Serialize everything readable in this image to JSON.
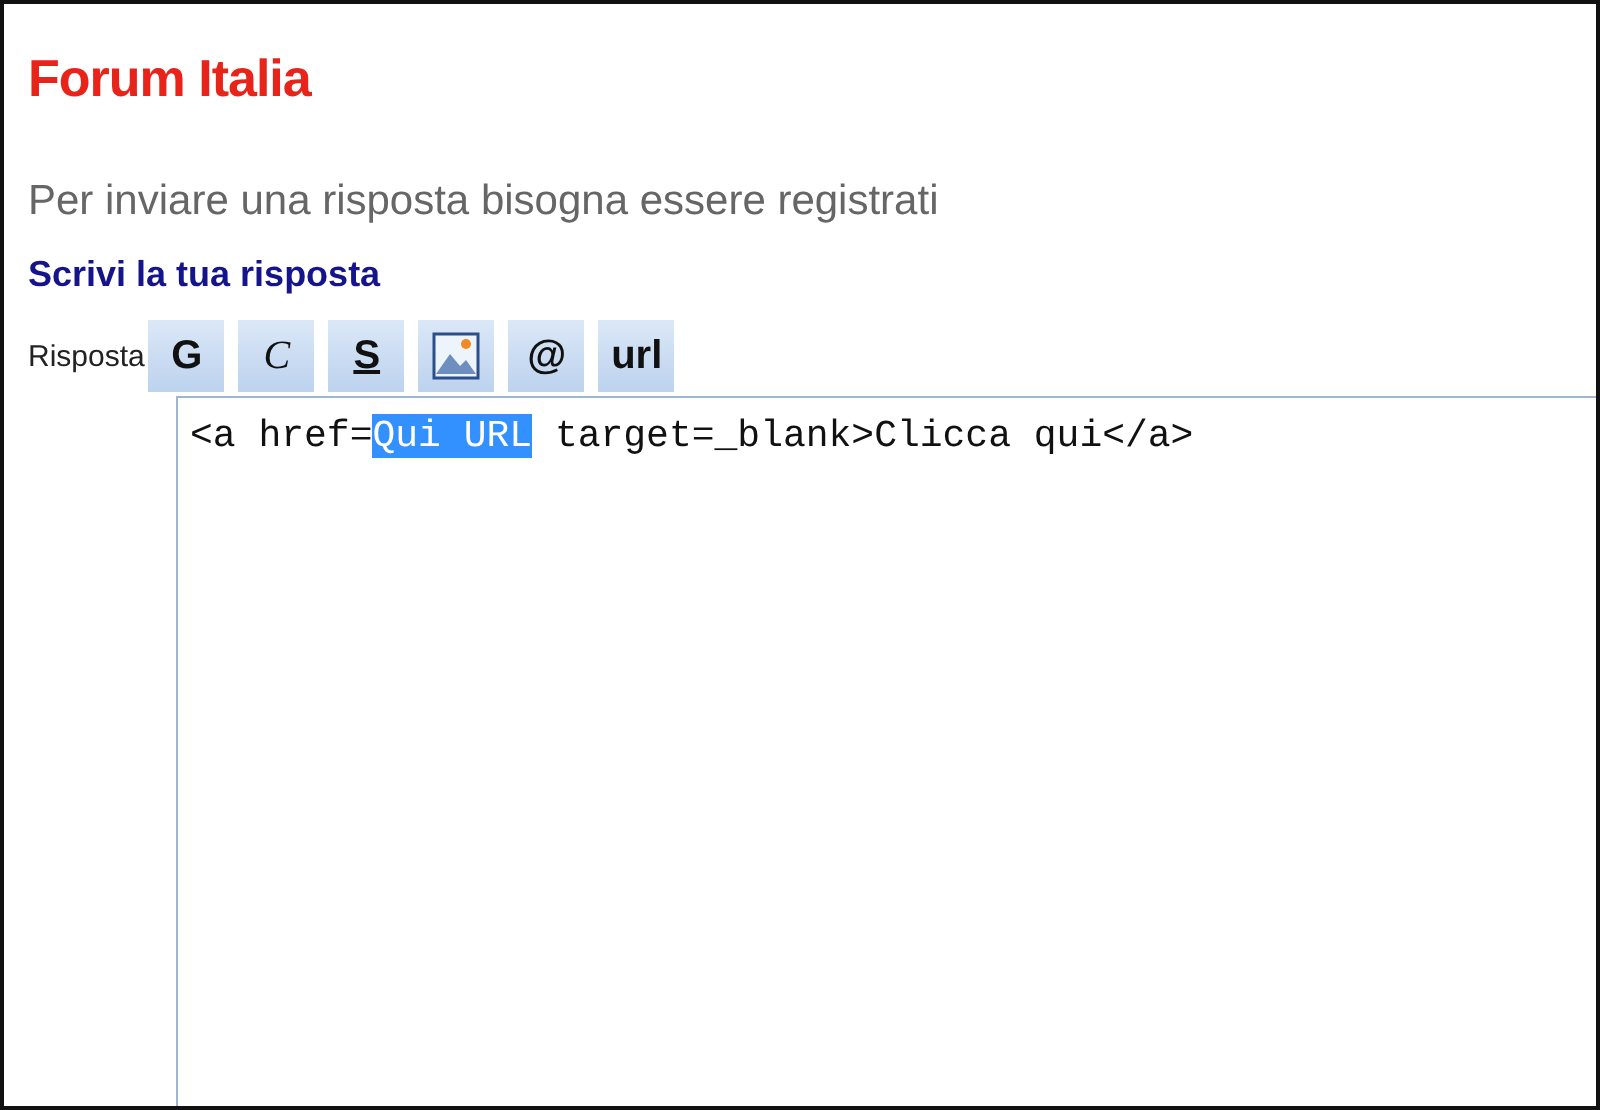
{
  "title": "Forum Italia",
  "notice": "Per inviare una risposta bisogna essere registrati",
  "section_heading": "Scrivi la tua risposta",
  "reply_label": "Risposta",
  "toolbar": [
    {
      "kind": "bold",
      "label": "G"
    },
    {
      "kind": "italic",
      "label": "C"
    },
    {
      "kind": "underline",
      "label": "S"
    },
    {
      "kind": "image"
    },
    {
      "kind": "email",
      "label": "@"
    },
    {
      "kind": "link",
      "label": "url"
    }
  ],
  "editor": {
    "text_before": "<a href=",
    "selected_text": "Qui URL",
    "text_after": " target=_blank>Clicca qui</a>"
  }
}
